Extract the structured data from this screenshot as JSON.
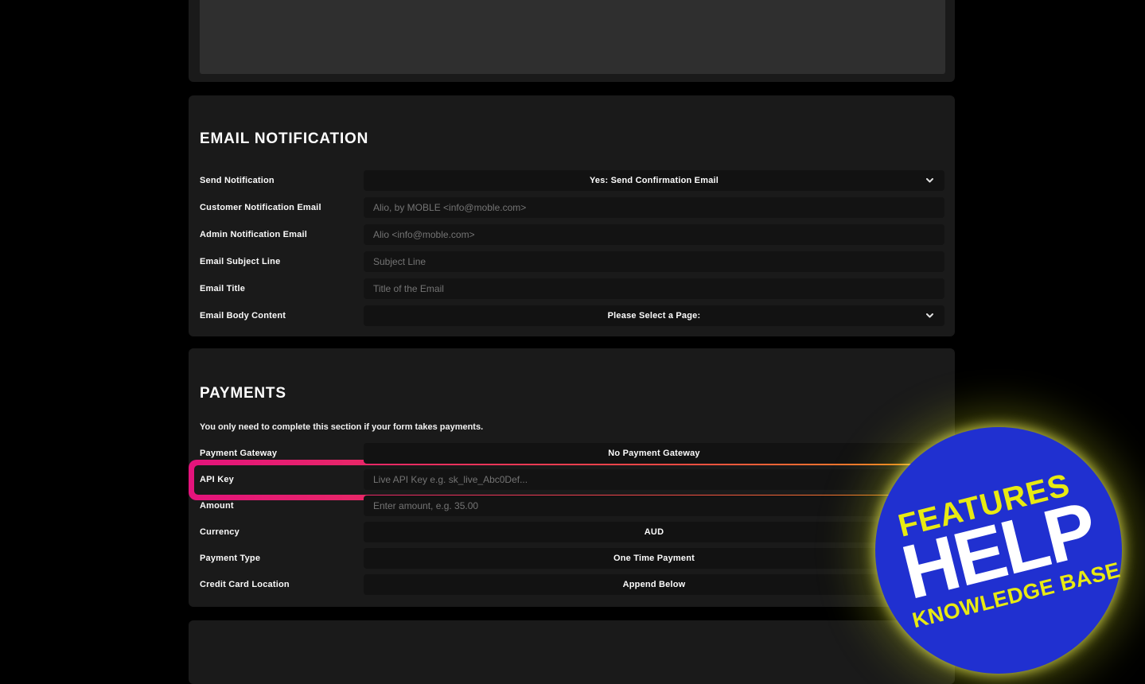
{
  "email": {
    "title": "EMAIL NOTIFICATION",
    "fields": [
      {
        "label": "Send Notification",
        "type": "select",
        "value": "Yes: Send Confirmation Email"
      },
      {
        "label": "Customer Notification Email",
        "type": "input",
        "placeholder": "Alio, by MOBLE <info@moble.com>"
      },
      {
        "label": "Admin Notification Email",
        "type": "input",
        "placeholder": "Alio <info@moble.com>"
      },
      {
        "label": "Email Subject Line",
        "type": "input",
        "placeholder": "Subject Line"
      },
      {
        "label": "Email Title",
        "type": "input",
        "placeholder": "Title of the Email"
      },
      {
        "label": "Email Body Content",
        "type": "select",
        "value": "Please Select a Page:"
      }
    ]
  },
  "payments": {
    "title": "PAYMENTS",
    "note": "You only need to complete this section if your form takes payments.",
    "fields": [
      {
        "label": "Payment Gateway",
        "type": "select",
        "value": "No Payment Gateway"
      },
      {
        "label": "API Key",
        "type": "input",
        "placeholder": "Live API Key e.g. sk_live_Abc0Def...",
        "highlighted": true
      },
      {
        "label": "Amount",
        "type": "input",
        "placeholder": "Enter amount, e.g. 35.00"
      },
      {
        "label": "Currency",
        "type": "select",
        "value": "AUD"
      },
      {
        "label": "Payment Type",
        "type": "select",
        "value": "One Time Payment"
      },
      {
        "label": "Credit Card Location",
        "type": "select",
        "value": "Append Below"
      }
    ]
  },
  "badge": {
    "line1": "FEATURES",
    "line2": "HELP",
    "line3": "KNOWLEDGE BASE",
    "background": "#2030d0",
    "text_yellow": "#e8ea12",
    "text_white": "#ffffff"
  },
  "highlight": {
    "gradient_start": "#e4137c",
    "gradient_end": "#f9991c"
  },
  "colors": {
    "page_background": "#000000",
    "panel_background": "#1a1a1a",
    "field_background": "#131313"
  }
}
